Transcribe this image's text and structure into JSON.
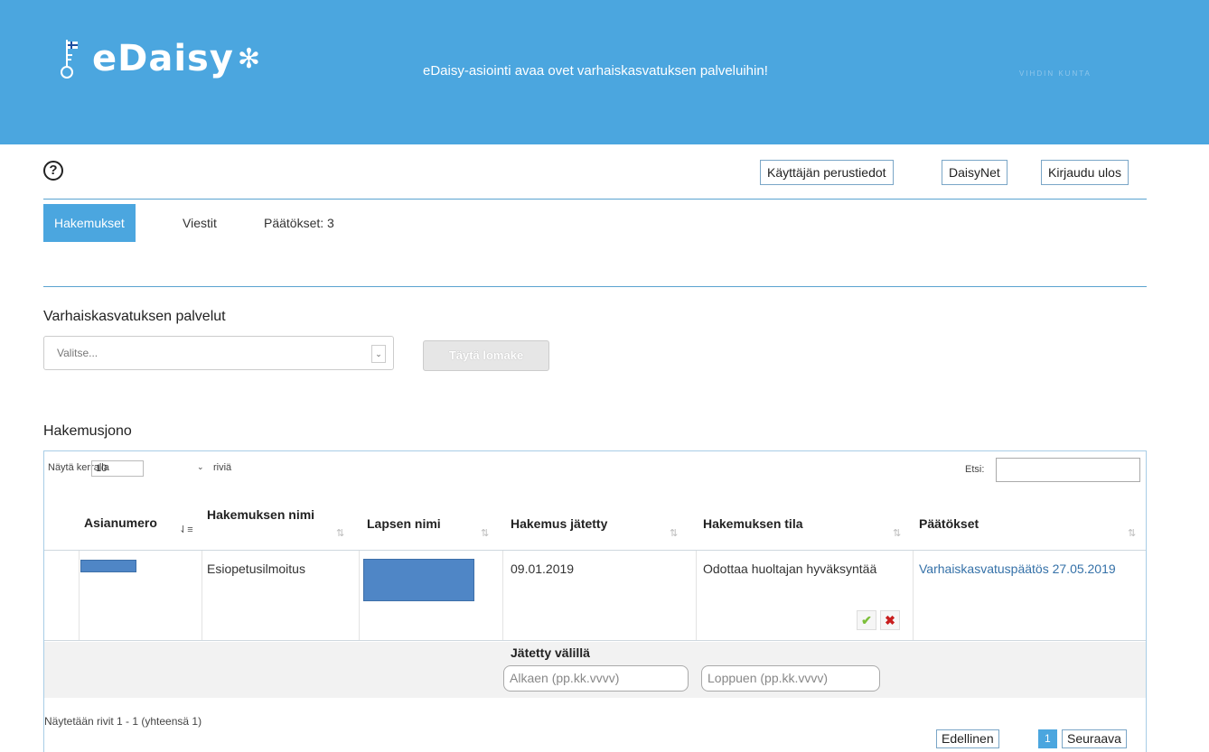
{
  "brand": {
    "logo_text": "eDaisy",
    "tagline": "eDaisy-asiointi avaa ovet varhaiskasvatuksen palveluihin!",
    "partner_logo": "VIHDIN KUNTA"
  },
  "header": {
    "help_label": "?",
    "buttons": {
      "user_info": "Käyttäjän perustiedot",
      "daisynet": "DaisyNet",
      "logout": "Kirjaudu ulos"
    }
  },
  "tabs": [
    {
      "label": "Hakemukset",
      "active": true
    },
    {
      "label": "Viestit",
      "active": false
    },
    {
      "label": "Päätökset: 3",
      "active": false
    }
  ],
  "services": {
    "title": "Varhaiskasvatuksen palvelut",
    "select_placeholder": "Valitse...",
    "fill_button": "Täytä lomake"
  },
  "queue": {
    "title": "Hakemusjono",
    "show_label": "Näytä kerralla",
    "show_value": "10",
    "rows_label": "riviä",
    "search_label": "Etsi:",
    "columns": [
      "Asianumero",
      "Hakemuksen nimi",
      "Lapsen nimi",
      "Hakemus jätetty",
      "Hakemuksen tila",
      "Päätökset"
    ],
    "rows": [
      {
        "case_number": "",
        "application_name": "Esiopetusilmoitus",
        "child_name": "",
        "submitted": "09.01.2019",
        "status": "Odottaa huoltajan hyväksyntää",
        "decision_link": "Varhaiskasvatuspäätös 27.05.2019"
      }
    ],
    "filter": {
      "label": "Jätetty välillä",
      "from_placeholder": "Alkaen (pp.kk.vvvv)",
      "to_placeholder": "Loppuen (pp.kk.vvvv)"
    },
    "info": "Näytetään rivit 1 - 1 (yhteensä 1)",
    "pagination": {
      "prev": "Edellinen",
      "current": "1",
      "next": "Seuraava"
    }
  },
  "colors": {
    "brand_blue": "#4ba6df",
    "link_blue": "#3571a8",
    "redaction": "#4f86c6",
    "approve": "#7cbf3a",
    "reject": "#c81e1e"
  },
  "icons": [
    "key-icon",
    "help-icon",
    "sort-icon",
    "approve-check-icon",
    "reject-cross-icon",
    "dropdown-arrow-icon"
  ]
}
